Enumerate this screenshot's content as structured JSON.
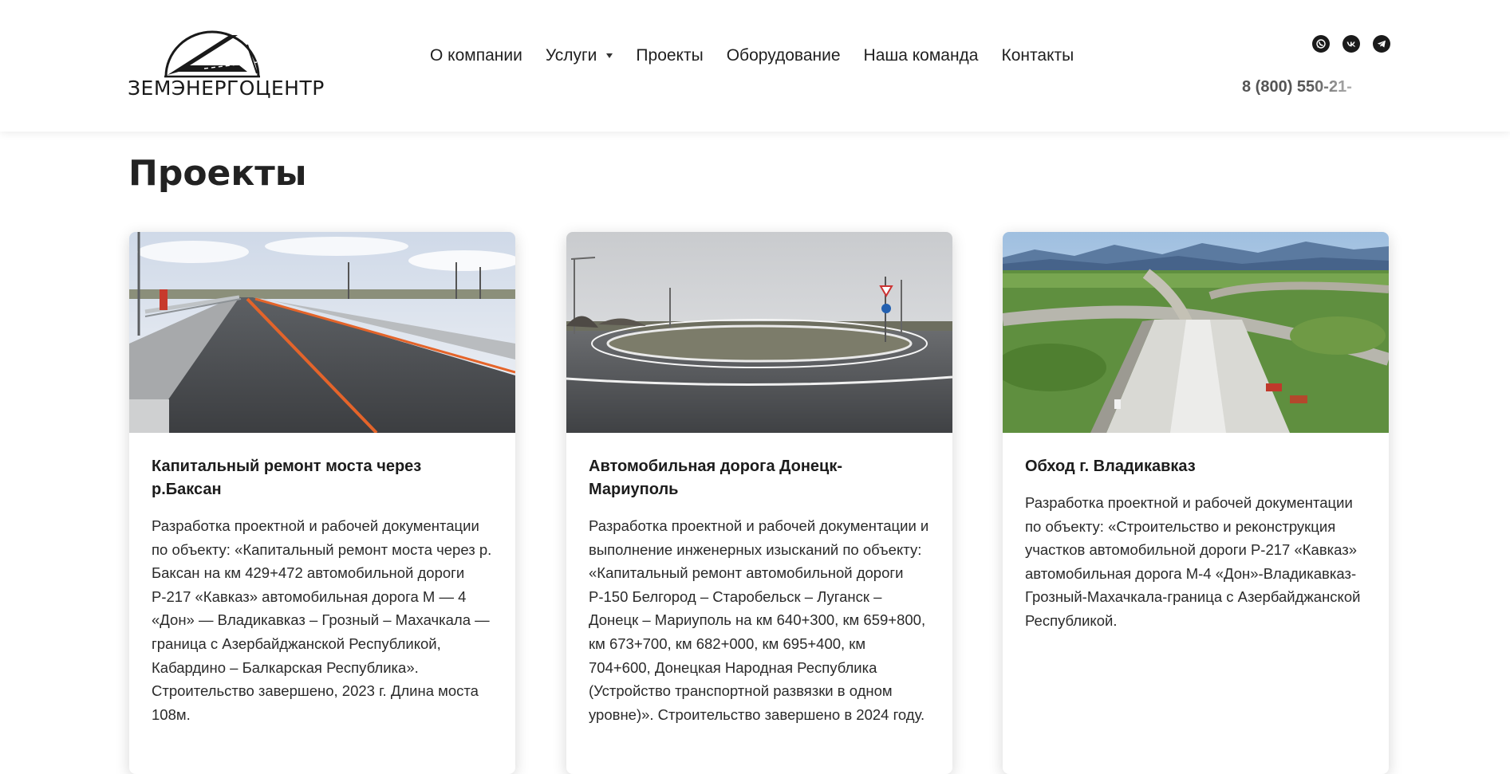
{
  "header": {
    "logo_text": "ЗЕМЭНЕРГОЦЕНТР",
    "nav": [
      {
        "label": "О компании"
      },
      {
        "label": "Услуги",
        "has_dropdown": true
      },
      {
        "label": "Проекты"
      },
      {
        "label": "Оборудование"
      },
      {
        "label": "Наша команда"
      },
      {
        "label": "Контакты"
      }
    ],
    "socials": [
      "whatsapp-icon",
      "vk-icon",
      "telegram-icon"
    ],
    "phone": "8 (800) 550-21-"
  },
  "page": {
    "title": "Проекты"
  },
  "projects": [
    {
      "title": "Капитальный ремонт моста через р.Баксан",
      "description": "Разработка проектной и рабочей документации  по объекту: «Капитальный ремонт моста через р. Баксан на км 429+472 автомобильной дороги Р-217 «Кавказ» автомобильная дорога М — 4 «Дон» — Владикавказ – Грозный – Махачкала — граница с Азербайджанской Республикой, Кабардино – Балкарская Республика». Строительство завершено, 2023 г. Длина моста 108м."
    },
    {
      "title": "Автомобильная дорога Донецк-Мариуполь",
      "description": "Разработка проектной и рабочей документации и выполнение инженерных изысканий по объекту: «Капитальный ремонт автомобильной дороги Р-150 Белгород – Старобельск – Луганск – Донецк – Мариуполь на км 640+300, км 659+800, км 673+700, км 682+000, км 695+400, км 704+600, Донецкая Народная Республика (Устройство транспортной развязки в одном уровне)». Строительство завершено в 2024 году."
    },
    {
      "title": "Обход г. Владикавказ",
      "description": "Разработка проектной и рабочей документации по объекту: «Строительство и реконструкция участков автомобильной дороги Р-217 «Кавказ» автомобильная дорога М-4 «Дон»-Владикавказ-Грозный-Махачкала-граница с Азербайджанской Республикой."
    }
  ]
}
